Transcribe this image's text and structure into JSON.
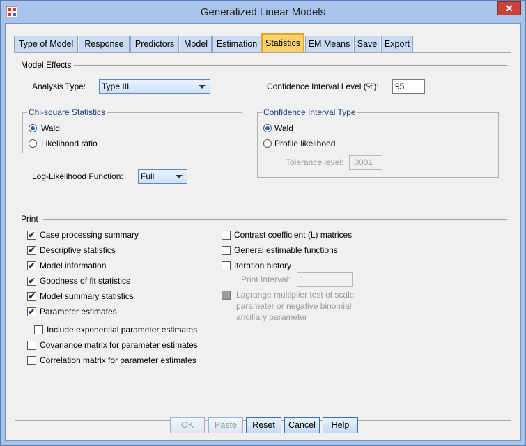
{
  "window": {
    "title": "Generalized Linear Models",
    "close_glyph": "✕"
  },
  "tabs": [
    {
      "label": "Type of Model",
      "active": false
    },
    {
      "label": "Response",
      "active": false
    },
    {
      "label": "Predictors",
      "active": false
    },
    {
      "label": "Model",
      "active": false
    },
    {
      "label": "Estimation",
      "active": false
    },
    {
      "label": "Statistics",
      "active": true
    },
    {
      "label": "EM Means",
      "active": false
    },
    {
      "label": "Save",
      "active": false
    },
    {
      "label": "Export",
      "active": false
    }
  ],
  "model_effects": {
    "section_label": "Model Effects",
    "analysis_type_label": "Analysis Type:",
    "analysis_type_value": "Type III",
    "ci_level_label": "Confidence Interval Level (%):",
    "ci_level_value": "95",
    "chi_square": {
      "title": "Chi-square Statistics",
      "wald_label": "Wald",
      "likelihood_label": "Likelihood ratio",
      "selected": "Wald"
    },
    "ci_type": {
      "title": "Confidence Interval Type",
      "wald_label": "Wald",
      "profile_label": "Profile likelihood",
      "selected": "Wald",
      "tolerance_label": "Tolerance level:",
      "tolerance_value": ".0001"
    },
    "loglik_label": "Log-Likelihood Function:",
    "loglik_value": "Full"
  },
  "print": {
    "section_label": "Print",
    "case_processing": {
      "label": "Case processing summary",
      "checked": true
    },
    "descriptive": {
      "label": "Descriptive statistics",
      "checked": true
    },
    "model_info": {
      "label": "Model information",
      "checked": true
    },
    "goodness_fit": {
      "label": "Goodness of fit statistics",
      "checked": true
    },
    "model_summary": {
      "label": "Model summary statistics",
      "checked": true
    },
    "param_estimates": {
      "label": "Parameter estimates",
      "checked": true
    },
    "include_exp": {
      "label": "Include exponential parameter estimates",
      "checked": false
    },
    "covariance": {
      "label": "Covariance matrix for parameter estimates",
      "checked": false
    },
    "correlation": {
      "label": "Correlation matrix for parameter estimates",
      "checked": false
    },
    "contrast": {
      "label": "Contrast coefficient (L) matrices",
      "checked": false
    },
    "general_estimable": {
      "label": "General estimable functions",
      "checked": false
    },
    "iteration": {
      "label": "Iteration history",
      "checked": false
    },
    "print_interval_label": "Print Interval:",
    "print_interval_value": "1",
    "lagrange": {
      "line1": "Lagrange multiplier test of scale",
      "line2": "parameter or negative binomial",
      "line3": "ancillary parameter",
      "checked": false
    }
  },
  "buttons": {
    "ok": "OK",
    "paste": "Paste",
    "reset": "Reset",
    "cancel": "Cancel",
    "help": "Help"
  },
  "check_glyph": "✔"
}
